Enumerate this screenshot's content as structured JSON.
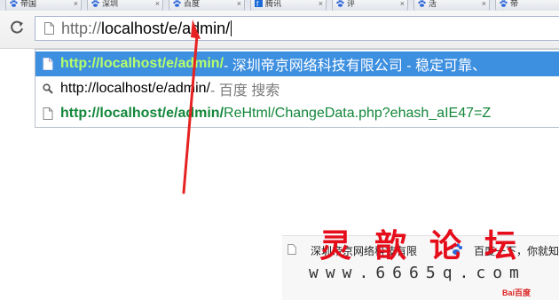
{
  "tabs": [
    {
      "label": "帝国",
      "icon": "paw-icon"
    },
    {
      "label": "深圳",
      "icon": "paw-icon"
    },
    {
      "label": "百度",
      "icon": "paw-icon"
    },
    {
      "label": "腾讯",
      "icon": "blue-f-icon"
    },
    {
      "label": "评",
      "icon": "paw-icon"
    },
    {
      "label": "活",
      "icon": "paw-icon"
    },
    {
      "label": "帝",
      "icon": "paw-icon"
    }
  ],
  "tab_close": "×",
  "toolbar": {
    "reload_icon": "reload-icon",
    "omnibox": {
      "prefix": "http://",
      "host_path": "localhost/e/admin/"
    }
  },
  "suggestions": [
    {
      "bold": "http://localhost/e/admin/",
      "rest": " - 深圳帝京网络科技有限公司 - 稳定可靠、",
      "icon": "page-icon",
      "selected": true
    },
    {
      "bold": "",
      "rest": "http://localhost/e/admin/",
      "gray": " - 百度 搜索",
      "icon": "search-icon",
      "selected": false
    },
    {
      "bold": "http://localhost/e/admin/",
      "rest": "ReHtml/ChangeData.php?ehash_aIE47=Z",
      "icon": "page-icon",
      "selected": false
    }
  ],
  "bottom": {
    "tile1": "深圳帝京网络科技有限",
    "tile2": "百度一下，你就知",
    "baidu_mini": "Bai百度"
  },
  "watermark": {
    "title": "灵歆论坛",
    "url": "www.6665q.com"
  },
  "colors": {
    "selected_bg": "#3d8fe0",
    "url_green": "#13873a",
    "arrow": "#e62222"
  }
}
